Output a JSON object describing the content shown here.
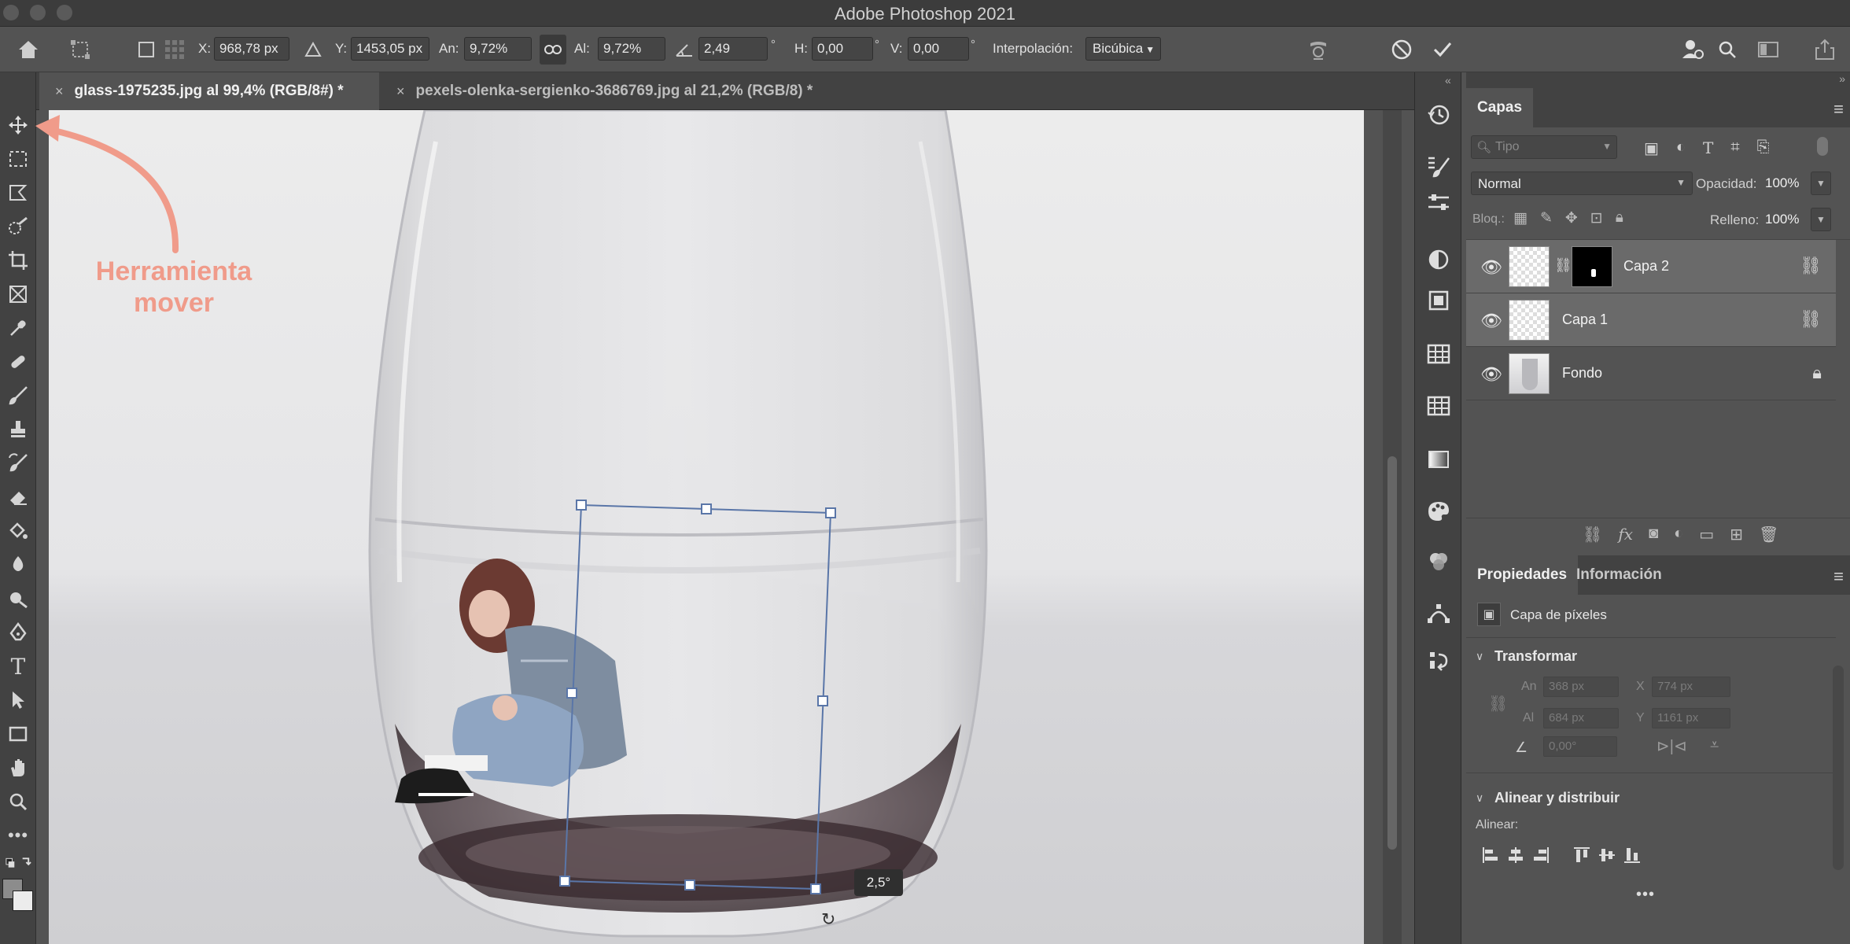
{
  "window": {
    "title": "Adobe Photoshop 2021"
  },
  "options_bar": {
    "x_label": "X:",
    "x_value": "968,78 px",
    "y_label": "Y:",
    "y_value": "1453,05 px",
    "width_label": "An:",
    "width_value": "9,72%",
    "height_label": "Al:",
    "height_value": "9,72%",
    "angle_value": "2,49",
    "angle_unit": "°",
    "h_skew_label": "H:",
    "h_skew_value": "0,00",
    "h_skew_unit": "°",
    "v_skew_label": "V:",
    "v_skew_value": "0,00",
    "v_skew_unit": "°",
    "interpolation_label": "Interpolación:",
    "interpolation_value": "Bicúbica"
  },
  "tabs": [
    {
      "close": "×",
      "label": "glass-1975235.jpg al 99,4% (RGB/8#) *",
      "active": true
    },
    {
      "close": "×",
      "label": "pexels-olenka-sergienko-3686769.jpg al 21,2% (RGB/8) *",
      "active": false
    }
  ],
  "annotation": {
    "line1": "Herramienta",
    "line2": "mover",
    "color": "#f09b8a"
  },
  "canvas": {
    "angle_badge": "2,5°"
  },
  "layers_panel": {
    "title": "Capas",
    "search_placeholder": "Tipo",
    "blend_mode": "Normal",
    "opacity_label": "Opacidad:",
    "opacity_value": "100%",
    "lock_label": "Bloq.:",
    "fill_label": "Relleno:",
    "fill_value": "100%",
    "layers": [
      {
        "name": "Capa 2",
        "selected": true
      },
      {
        "name": "Capa 1",
        "selected": true
      },
      {
        "name": "Fondo",
        "selected": false
      }
    ]
  },
  "properties_panel": {
    "tab_active": "Propiedades",
    "tab_inactive": "Información",
    "layer_type": "Capa de píxeles",
    "transform_title": "Transformar",
    "w_label": "An",
    "w_value": "368 px",
    "x_label": "X",
    "x_value": "774 px",
    "h_label": "Al",
    "h_value": "684 px",
    "y_label": "Y",
    "y_value": "1161 px",
    "angle_value": "0,00°",
    "align_title": "Alinear y distribuir",
    "align_label": "Alinear:",
    "more": "•••"
  },
  "colors": {
    "accent": "#f09b8a",
    "panel": "#535353",
    "dark": "#424242"
  }
}
